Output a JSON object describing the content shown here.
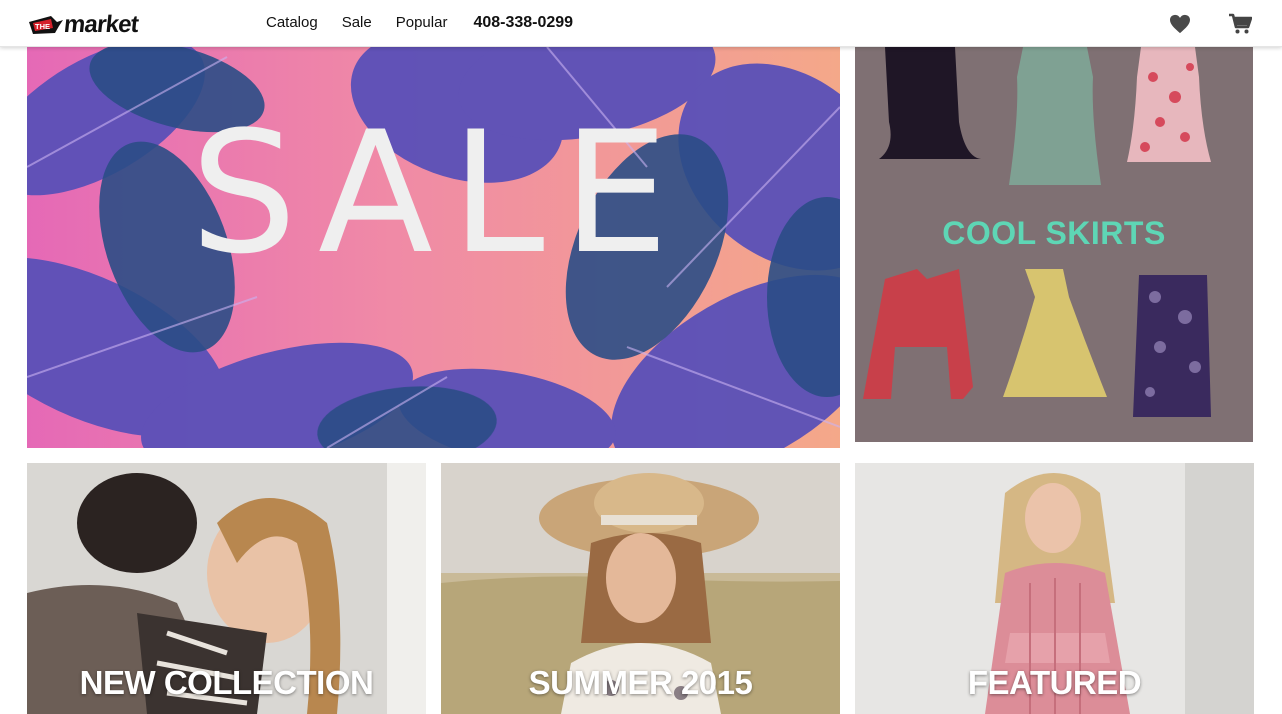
{
  "header": {
    "logo_tag": "THE",
    "logo_text": "market",
    "nav": [
      "Catalog",
      "Sale",
      "Popular"
    ],
    "phone": "408-338-0299",
    "icons": {
      "favorites": "heart-icon",
      "cart": "cart-icon"
    }
  },
  "tiles": {
    "sale": {
      "label": "SALE"
    },
    "cool_skirts": {
      "label": "COOL SKIRTS"
    },
    "new_collection": {
      "label": "NEW COLLECTION"
    },
    "summer": {
      "label": "SUMMER 2015"
    },
    "featured": {
      "label": "FEATURED"
    }
  },
  "colors": {
    "header_bg": "#ffffff",
    "text": "#111111",
    "accent_skirts": "#5ed6b5",
    "skirts_bg": "#7f7073",
    "sale_text": "#efefef",
    "logo_red": "#d4202a"
  }
}
